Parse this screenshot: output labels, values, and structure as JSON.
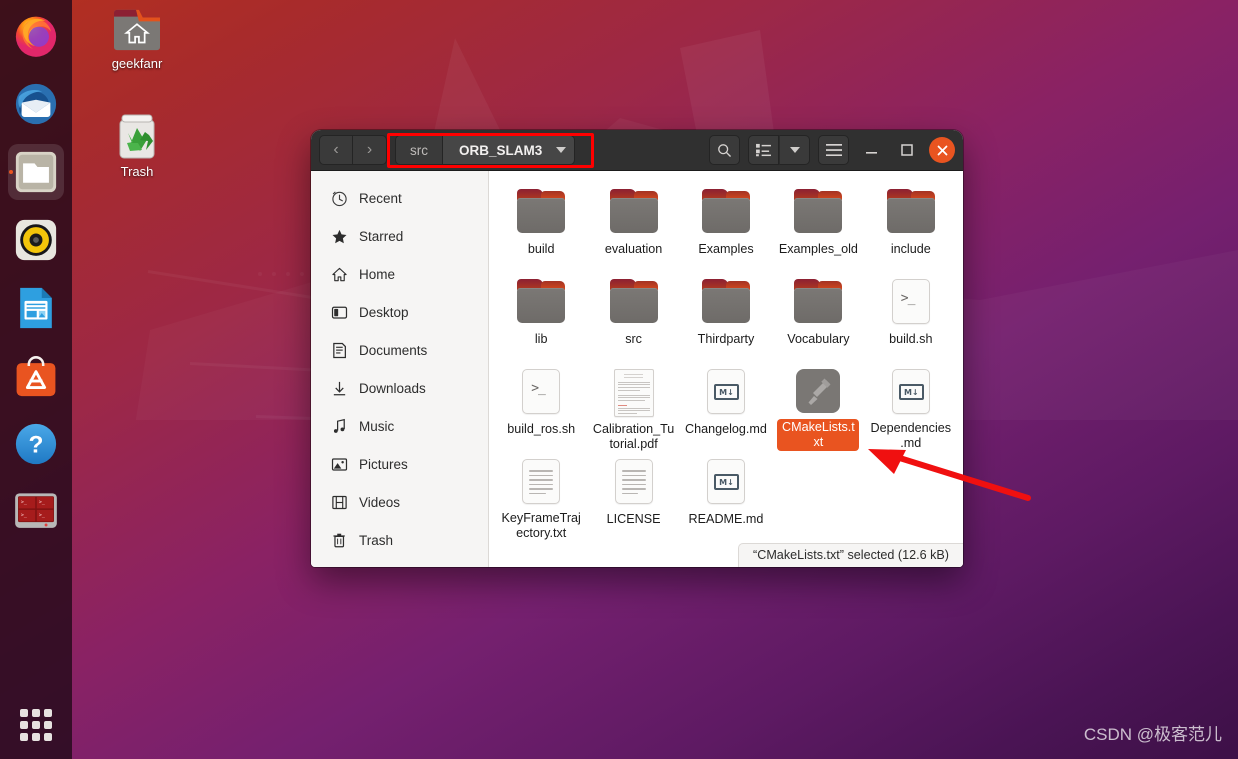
{
  "desktop": {
    "icons": [
      {
        "name": "geekfanr",
        "icon": "home-folder-icon"
      },
      {
        "name": "Trash",
        "icon": "trash-icon"
      }
    ],
    "watermark": "CSDN @极客范儿",
    "wallpaper_colors": {
      "top": "#b4301f",
      "bottom": "#3d1047"
    }
  },
  "dock": {
    "items": [
      {
        "name": "Firefox",
        "icon": "firefox-icon",
        "running": false
      },
      {
        "name": "Thunderbird Mail",
        "icon": "thunderbird-icon",
        "running": false
      },
      {
        "name": "Files",
        "icon": "files-icon",
        "running": true
      },
      {
        "name": "Rhythmbox",
        "icon": "rhythmbox-icon",
        "running": false
      },
      {
        "name": "LibreOffice Writer",
        "icon": "libreoffice-writer-icon",
        "running": false
      },
      {
        "name": "Ubuntu Software",
        "icon": "ubuntu-software-icon",
        "running": false
      },
      {
        "name": "Help",
        "icon": "help-icon",
        "running": false
      },
      {
        "name": "Terminal",
        "icon": "terminal-icon",
        "running": false
      }
    ],
    "show_applications_label": "Show Applications"
  },
  "window": {
    "titlebar": {
      "back_label": "‹",
      "forward_label": "›",
      "path": [
        {
          "label": "src",
          "current": false
        },
        {
          "label": "ORB_SLAM3",
          "current": true
        }
      ],
      "search_icon": "search-icon",
      "list_view_icon": "list-view-icon",
      "view_options_icon": "chevron-down-icon",
      "menu_icon": "hamburger-menu-icon",
      "minimize_label": "–",
      "maximize_label": "□",
      "close_label": "✕",
      "accent_color": "#e95420"
    },
    "sidebar": {
      "items": [
        {
          "label": "Recent",
          "icon": "clock-icon"
        },
        {
          "label": "Starred",
          "icon": "star-icon"
        },
        {
          "label": "Home",
          "icon": "home-icon"
        },
        {
          "label": "Desktop",
          "icon": "desktop-icon"
        },
        {
          "label": "Documents",
          "icon": "documents-icon"
        },
        {
          "label": "Downloads",
          "icon": "download-icon"
        },
        {
          "label": "Music",
          "icon": "music-note-icon"
        },
        {
          "label": "Pictures",
          "icon": "picture-icon"
        },
        {
          "label": "Videos",
          "icon": "film-icon"
        },
        {
          "label": "Trash",
          "icon": "trash-icon"
        }
      ]
    },
    "files": [
      {
        "name": "build",
        "type": "folder",
        "selected": false
      },
      {
        "name": "evaluation",
        "type": "folder",
        "selected": false
      },
      {
        "name": "Examples",
        "type": "folder",
        "selected": false
      },
      {
        "name": "Examples_old",
        "type": "folder",
        "selected": false
      },
      {
        "name": "include",
        "type": "folder",
        "selected": false
      },
      {
        "name": "lib",
        "type": "folder",
        "selected": false
      },
      {
        "name": "src",
        "type": "folder",
        "selected": false
      },
      {
        "name": "Thirdparty",
        "type": "folder",
        "selected": false
      },
      {
        "name": "Vocabulary",
        "type": "folder",
        "selected": false
      },
      {
        "name": "build.sh",
        "type": "shell",
        "selected": false
      },
      {
        "name": "build_ros.sh",
        "type": "shell",
        "selected": false
      },
      {
        "name": "Calibration_Tutorial.pdf",
        "type": "pdf",
        "selected": false
      },
      {
        "name": "Changelog.md",
        "type": "markdown",
        "selected": false
      },
      {
        "name": "CMakeLists.txt",
        "type": "cmake",
        "selected": true
      },
      {
        "name": "Dependencies.md",
        "type": "markdown",
        "selected": false
      },
      {
        "name": "KeyFrameTrajectory.txt",
        "type": "text",
        "selected": false
      },
      {
        "name": "LICENSE",
        "type": "text",
        "selected": false
      },
      {
        "name": "README.md",
        "type": "markdown",
        "selected": false
      }
    ],
    "statusbar": "“CMakeLists.txt” selected  (12.6 kB)"
  },
  "annotations": {
    "path_highlight_color": "#ff0000",
    "arrow_color": "#f01010",
    "arrow_target": "CMakeLists.txt"
  }
}
